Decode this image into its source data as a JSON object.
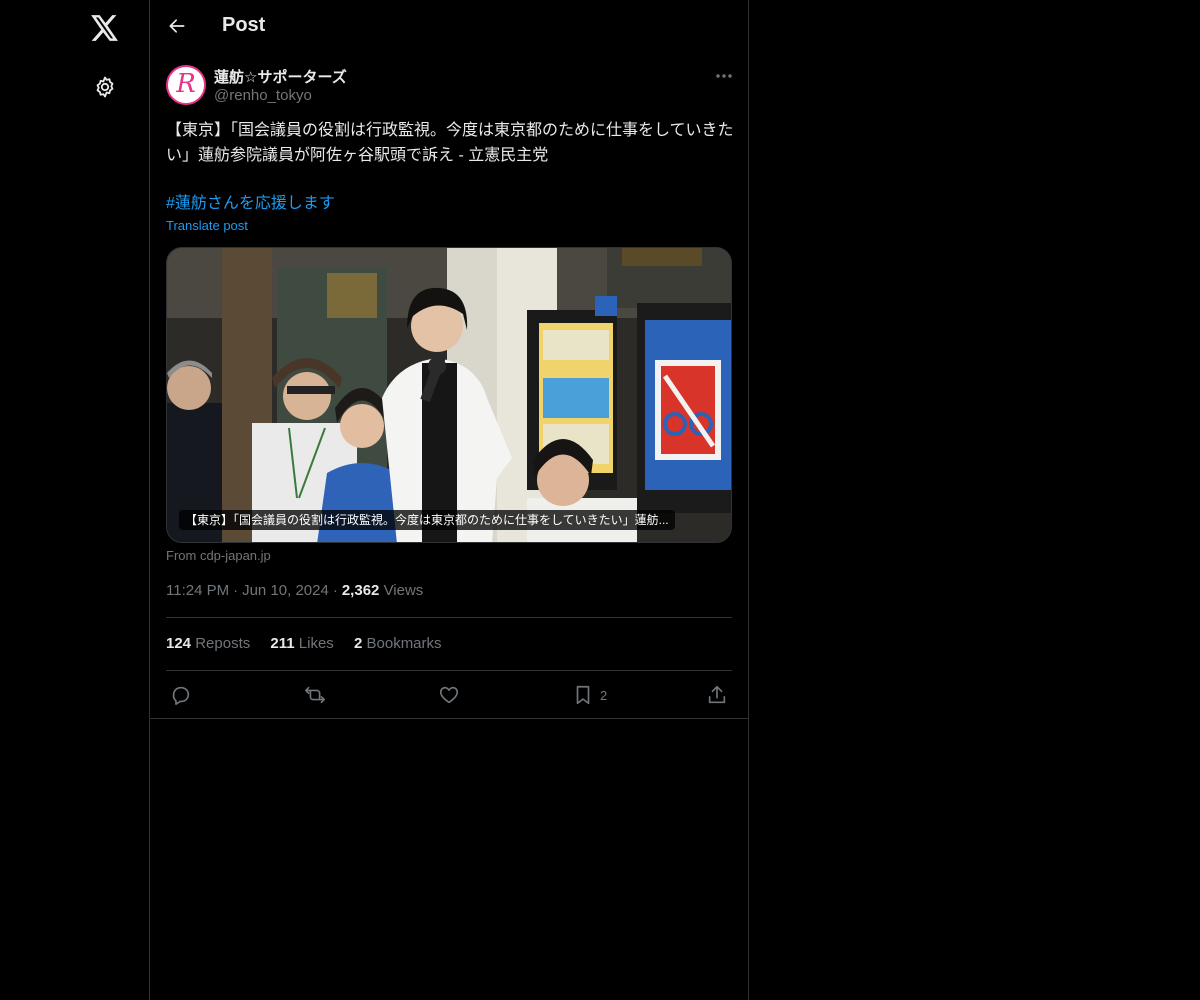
{
  "nav": {
    "logo_icon": "x-logo-icon",
    "settings_icon": "gear-icon"
  },
  "header": {
    "title": "Post",
    "back_icon": "arrow-left-icon"
  },
  "author": {
    "avatar_letter": "R",
    "name": "蓮舫☆サポーターズ",
    "handle": "@renho_tokyo"
  },
  "post": {
    "text": "【東京】「国会議員の役割は行政監視。今度は東京都のために仕事をしていきたい」蓮舫参院議員が阿佐ヶ谷駅頭で訴え - 立憲民主党",
    "hashtag": "#蓮舫さんを応援します",
    "translate_label": "Translate post"
  },
  "media": {
    "caption": "【東京】「国会議員の役割は行政監視。今度は東京都のために仕事をしていきたい」蓮舫...",
    "source": "From cdp-japan.jp"
  },
  "meta": {
    "time": "11:24 PM",
    "date": "Jun 10, 2024",
    "views_count": "2,362",
    "views_label": "Views"
  },
  "stats": {
    "reposts_count": "124",
    "reposts_label": "Reposts",
    "likes_count": "211",
    "likes_label": "Likes",
    "bookmarks_count": "2",
    "bookmarks_label": "Bookmarks"
  },
  "actions": {
    "reply_icon": "reply-icon",
    "repost_icon": "repost-icon",
    "like_icon": "heart-icon",
    "bookmark_icon": "bookmark-icon",
    "bookmark_count": "2",
    "share_icon": "share-icon"
  },
  "colors": {
    "background": "#000000",
    "text": "#e7e9ea",
    "secondary": "#71767b",
    "accent": "#1d9bf0",
    "border": "#2f3336"
  }
}
